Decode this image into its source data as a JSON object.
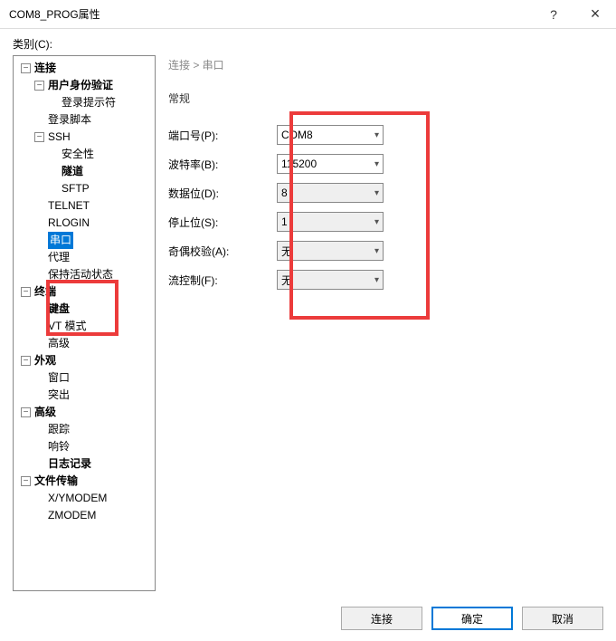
{
  "titlebar": {
    "title": "COM8_PROG属性",
    "help": "?",
    "close": "×"
  },
  "category_label": "类别(C):",
  "breadcrumb": "连接 > 串口",
  "section_title": "常规",
  "tree": {
    "connection": "连接",
    "auth": "用户身份验证",
    "login_prompt": "登录提示符",
    "login_script": "登录脚本",
    "ssh": "SSH",
    "security": "安全性",
    "tunnel": "隧道",
    "sftp": "SFTP",
    "telnet": "TELNET",
    "rlogin": "RLOGIN",
    "serial": "串口",
    "proxy": "代理",
    "keepalive": "保持活动状态",
    "terminal": "终端",
    "keyboard": "键盘",
    "vtmode": "VT 模式",
    "advanced_t": "高级",
    "appearance": "外观",
    "window": "窗口",
    "highlight": "突出",
    "advanced": "高级",
    "trace": "跟踪",
    "bell": "响铃",
    "logging": "日志记录",
    "filetransfer": "文件传输",
    "xymodem": "X/YMODEM",
    "zmodem": "ZMODEM"
  },
  "form": {
    "port_label": "端口号(P):",
    "port_value": "COM8",
    "baud_label": "波特率(B):",
    "baud_value": "115200",
    "databits_label": "数据位(D):",
    "databits_value": "8",
    "stopbits_label": "停止位(S):",
    "stopbits_value": "1",
    "parity_label": "奇偶校验(A):",
    "parity_value": "无",
    "flow_label": "流控制(F):",
    "flow_value": "无"
  },
  "buttons": {
    "connect": "连接",
    "ok": "确定",
    "cancel": "取消"
  },
  "icons": {
    "minus": "−",
    "chevron": "▾"
  }
}
